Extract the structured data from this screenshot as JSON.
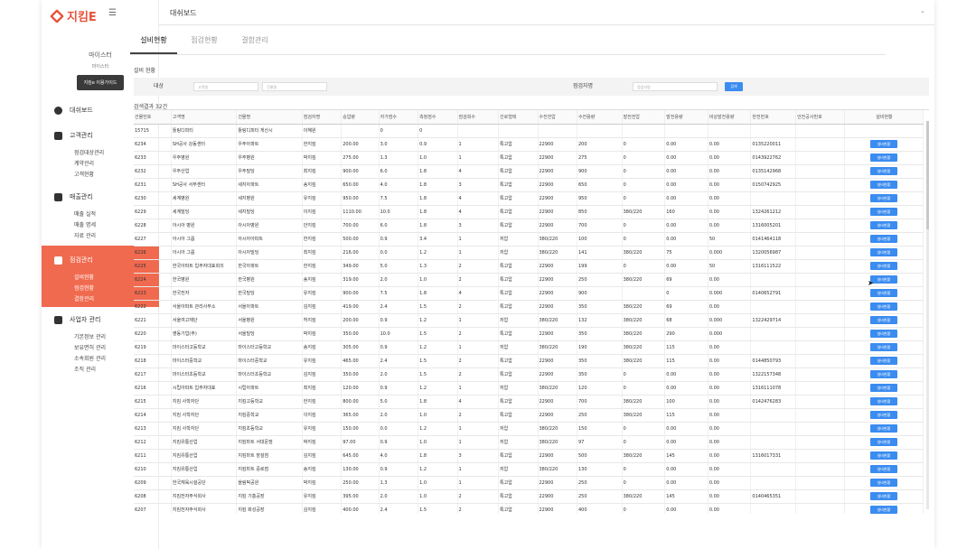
{
  "app": {
    "logo_text": "지킴E",
    "menu_toggle": "☰"
  },
  "user": {
    "name": "마이스터",
    "sub": "마이스터",
    "guide_button": "지킴e 이용가이드"
  },
  "sidebar": {
    "dashboard": "대쉬보드",
    "customer": {
      "label": "고객관리",
      "items": [
        "점검대상관리",
        "계약관리",
        "고객현황"
      ]
    },
    "sales": {
      "label": "매출관리",
      "items": [
        "매출 실적",
        "매출 명세",
        "자료 관리"
      ]
    },
    "inspection": {
      "label": "점검관리",
      "items": [
        "설비현황",
        "점검현황",
        "결함관리"
      ]
    },
    "business": {
      "label": "사업자 관리",
      "items": [
        "기본정보 관리",
        "보유면허 관리",
        "소속회원 관리",
        "조직 관리"
      ]
    }
  },
  "header": {
    "title": "대쉬보드"
  },
  "tabs": [
    "설비현황",
    "점검현황",
    "결함관리"
  ],
  "filter": {
    "section_title": "설비 현황",
    "target_label": "대상",
    "customer_placeholder": "고객명",
    "building_placeholder": "건물명",
    "inspector_label": "점검자명",
    "inspector_placeholder": "점검자명",
    "search_button": "검색"
  },
  "result_count": "검색결과 32건",
  "table": {
    "columns": [
      "건물번호",
      "고객명",
      "건물명",
      "점검자명",
      "승압량",
      "자가점수",
      "측정점수",
      "점검회수",
      "선로형태",
      "수전전압",
      "수전용량",
      "발전전압",
      "발전용량",
      "비상발전용량",
      "한전번호",
      "안전공사번호",
      "설비현황"
    ],
    "row_button": "설비현황",
    "rows": [
      [
        "15715",
        "툴링디피티",
        "툴링디피티 게산시",
        "이혜원",
        "",
        "0",
        "0",
        "",
        "",
        "",
        "",
        "",
        "",
        "",
        "",
        "",
        ""
      ],
      [
        "6234",
        "SH공사 강동센터",
        "우주아파트",
        "한지킴",
        "200.00",
        "3.0",
        "0.9",
        "1",
        "특고압",
        "22900",
        "200",
        "0",
        "0.00",
        "0.00",
        "0135220011",
        "",
        "btn"
      ],
      [
        "6233",
        "우주병원",
        "우주병원",
        "박지킴",
        "275.00",
        "1.3",
        "1.0",
        "1",
        "특고압",
        "22900",
        "275",
        "0",
        "0.00",
        "0.00",
        "0143922762",
        "",
        "btn"
      ],
      [
        "6232",
        "우주산업",
        "우주빌딩",
        "최지킴",
        "900.00",
        "6.0",
        "1.8",
        "4",
        "특고압",
        "22900",
        "900",
        "0",
        "0.00",
        "0.00",
        "0135142968",
        "",
        "btn"
      ],
      [
        "6231",
        "SH공사 서부센터",
        "세지아파트",
        "송지킴",
        "650.00",
        "4.0",
        "1.8",
        "3",
        "특고압",
        "22900",
        "650",
        "0",
        "0.00",
        "0.00",
        "0150742925",
        "",
        "btn"
      ],
      [
        "6230",
        "세계병원",
        "세지병원",
        "유지킴",
        "950.00",
        "7.5",
        "1.8",
        "4",
        "특고압",
        "22900",
        "950",
        "0",
        "0.00",
        "0.00",
        "",
        "",
        "btn"
      ],
      [
        "6229",
        "세계빌딩",
        "세지빌딩",
        "이지킴",
        "1110.00",
        "10.0",
        "1.8",
        "4",
        "특고압",
        "22900",
        "850",
        "380/220",
        "160",
        "0.00",
        "1324261212",
        "",
        "btn"
      ],
      [
        "6228",
        "아시아 병원",
        "아시아병원",
        "안지킴",
        "700.00",
        "6.0",
        "1.8",
        "3",
        "특고압",
        "22900",
        "700",
        "0",
        "0.00",
        "0.00",
        "1316005201",
        "",
        "btn"
      ],
      [
        "6227",
        "아시아 그룹",
        "아시아아파트",
        "한지킴",
        "500.00",
        "0.9",
        "3.4",
        "1",
        "저압",
        "380/220",
        "100",
        "0",
        "0.00",
        "50",
        "0141464118",
        "",
        "btn"
      ],
      [
        "6226",
        "아시아 그룹",
        "아시아빌딩",
        "최지킴",
        "216.00",
        "0.0",
        "1.2",
        "1",
        "저압",
        "380/220",
        "141",
        "380/220",
        "75",
        "0.000",
        "1320056987",
        "",
        "btn"
      ],
      [
        "6225",
        "한국아파트 입주자대표회의",
        "한국아파트",
        "한지킴",
        "349.00",
        "5.0",
        "1.3",
        "2",
        "특고압",
        "22900",
        "199",
        "0",
        "0.00",
        "50",
        "1316111522",
        "",
        "btn"
      ],
      [
        "6224",
        "한국병원",
        "한국병원",
        "송지킴",
        "319.00",
        "2.0",
        "1.0",
        "2",
        "특고압",
        "22900",
        "250",
        "380/220",
        "69",
        "0.00",
        "",
        "",
        "btn"
      ],
      [
        "6223",
        "한국전자",
        "한국빌딩",
        "유지킴",
        "900.00",
        "7.5",
        "1.8",
        "4",
        "특고압",
        "22900",
        "900",
        "",
        "0",
        "0.000",
        "0140652791",
        "",
        "btn"
      ],
      [
        "6222",
        "서울아파트 관리사무소",
        "서울아파트",
        "김지킴",
        "419.00",
        "2.4",
        "1.5",
        "2",
        "특고압",
        "22900",
        "350",
        "380/220",
        "69",
        "0.00",
        "",
        "",
        "btn"
      ],
      [
        "6221",
        "서울여고재단",
        "서울병원",
        "허지킴",
        "200.00",
        "0.9",
        "1.2",
        "1",
        "저압",
        "380/220",
        "132",
        "380/220",
        "68",
        "0.000",
        "1322429714",
        "",
        "btn"
      ],
      [
        "6220",
        "영동기업(주)",
        "서울빌딩",
        "박지킴",
        "350.00",
        "10.0",
        "1.5",
        "2",
        "특고압",
        "22900",
        "350",
        "380/220",
        "290",
        "0.000",
        "",
        "",
        "btn"
      ],
      [
        "6219",
        "마이스터고등학교",
        "마이스터고등학교",
        "송지킴",
        "305.00",
        "0.9",
        "1.2",
        "1",
        "저압",
        "380/220",
        "190",
        "380/220",
        "115",
        "0.00",
        "",
        "",
        "btn"
      ],
      [
        "6218",
        "마이스터중학교",
        "마이스터중학교",
        "유지킴",
        "465.00",
        "2.4",
        "1.5",
        "2",
        "특고압",
        "22900",
        "350",
        "380/220",
        "115",
        "0.00",
        "0144850793",
        "",
        "btn"
      ],
      [
        "6217",
        "마이스터초등학교",
        "마이스터초등학교",
        "김지킴",
        "350.00",
        "2.0",
        "1.5",
        "2",
        "특고압",
        "22900",
        "350",
        "0",
        "0.00",
        "0.00",
        "1322157348",
        "",
        "btn"
      ],
      [
        "6216",
        "시립아파트 입주자대표",
        "시립아파트",
        "최지킴",
        "120.00",
        "0.9",
        "1.2",
        "1",
        "저압",
        "380/220",
        "120",
        "0",
        "0.00",
        "0.00",
        "1316111078",
        "",
        "btn"
      ],
      [
        "6215",
        "지킴 사학자단",
        "지킴고등학교",
        "한지킴",
        "800.00",
        "5.0",
        "1.8",
        "4",
        "특고압",
        "22900",
        "700",
        "380/220",
        "100",
        "0.00",
        "0142476283",
        "",
        "btn"
      ],
      [
        "6214",
        "지킴 사학자단",
        "지킴중학교",
        "이지킴",
        "365.00",
        "2.0",
        "1.0",
        "2",
        "특고압",
        "22900",
        "250",
        "380/220",
        "115",
        "0.00",
        "",
        "",
        "btn"
      ],
      [
        "6213",
        "지킴 사학자단",
        "지킴초등학교",
        "유지킴",
        "150.00",
        "0.0",
        "1.2",
        "1",
        "저압",
        "380/220",
        "150",
        "0",
        "0.00",
        "0.00",
        "",
        "",
        "btn"
      ],
      [
        "6212",
        "지킴유통산업",
        "지킴마트 서대문점",
        "박지킴",
        "97.00",
        "0.9",
        "1.0",
        "1",
        "저압",
        "380/220",
        "97",
        "0",
        "0.00",
        "0.00",
        "",
        "",
        "btn"
      ],
      [
        "6211",
        "지킴유통산업",
        "지킴마트 장설점",
        "김지킴",
        "645.00",
        "4.0",
        "1.8",
        "3",
        "특고압",
        "22900",
        "500",
        "380/220",
        "145",
        "0.00",
        "1316017331",
        "",
        "btn"
      ],
      [
        "6210",
        "지킴유통산업",
        "지킴마트 중로점",
        "송지킴",
        "130.00",
        "0.9",
        "1.2",
        "1",
        "저압",
        "380/220",
        "130",
        "0",
        "0.00",
        "0.00",
        "",
        "",
        "btn"
      ],
      [
        "6209",
        "한국체육시설공단",
        "올림픽공원",
        "박지킴",
        "250.00",
        "1.3",
        "1.0",
        "1",
        "특고압",
        "22900",
        "250",
        "0",
        "0.00",
        "0.00",
        "",
        "",
        "btn"
      ],
      [
        "6208",
        "지킴전자주식회사",
        "지킴 기흥공장",
        "유지킴",
        "395.00",
        "2.0",
        "1.0",
        "2",
        "특고압",
        "22900",
        "250",
        "380/220",
        "145",
        "0.00",
        "0140465351",
        "",
        "btn"
      ],
      [
        "6207",
        "지킴전자주식회사",
        "지킴 화성공장",
        "김지킴",
        "400.00",
        "2.4",
        "1.5",
        "2",
        "특고압",
        "22900",
        "400",
        "0",
        "0.00",
        "0.00",
        "",
        "",
        "btn"
      ],
      [
        "6206",
        "지킴전자주식회사",
        "지킴 평택공장",
        "유지킴",
        "550.00",
        "3.0",
        "1.4",
        "2",
        "특고압",
        "22900",
        "550",
        "0",
        "0.00",
        "0.00",
        "",
        "",
        "btn"
      ]
    ]
  },
  "colors": {
    "accent": "#f06a4f",
    "button": "#3b8cf0",
    "logo": "#e8523a"
  }
}
